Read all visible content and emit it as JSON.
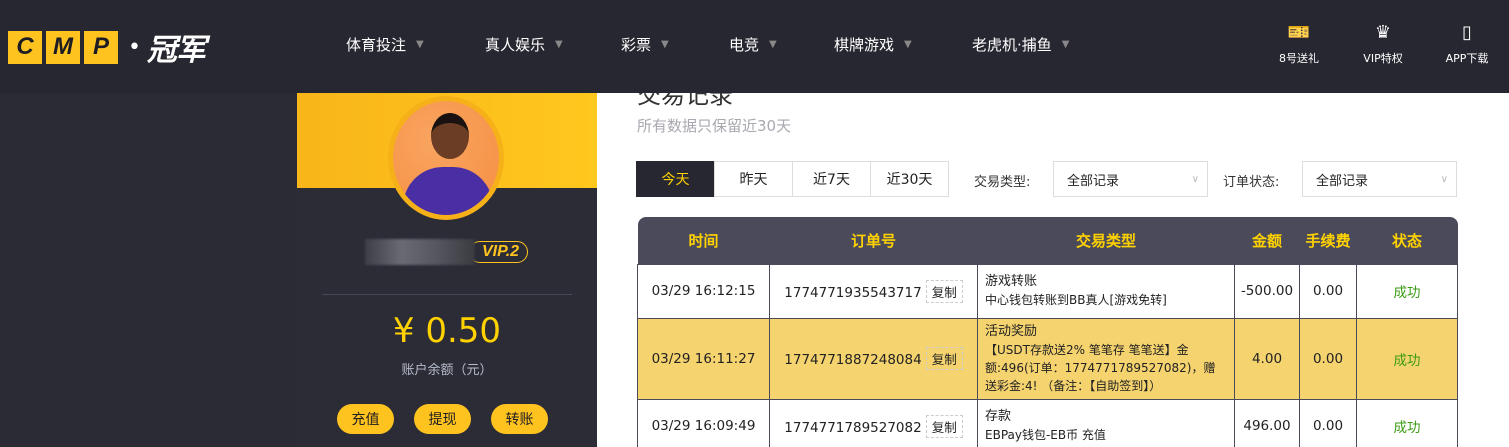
{
  "header": {
    "logo_letters": [
      "C",
      "M",
      "P"
    ],
    "logo_text": "冠军",
    "menu": [
      {
        "label": "体育投注"
      },
      {
        "label": "真人娱乐"
      },
      {
        "label": "彩票"
      },
      {
        "label": "电竞"
      },
      {
        "label": "棋牌游戏"
      },
      {
        "label": "老虎机·捕鱼"
      }
    ],
    "right_icons": [
      {
        "label": "8号送礼",
        "icon": "ticket-yen-icon"
      },
      {
        "label": "VIP特权",
        "icon": "crown-icon"
      },
      {
        "label": "APP下载",
        "icon": "phone-icon"
      }
    ]
  },
  "sidebar": {
    "vip": "VIP.2",
    "balance": "¥ 0.50",
    "balance_label": "账户余额（元）",
    "buttons": [
      "充值",
      "提现",
      "转账"
    ]
  },
  "main": {
    "title": "交易记录",
    "subtitle": "所有数据只保留近30天",
    "date_tabs": [
      "今天",
      "昨天",
      "近7天",
      "近30天"
    ],
    "active_tab": 0,
    "type_label": "交易类型:",
    "type_value": "全部记录",
    "status_label": "订单状态:",
    "status_value": "全部记录",
    "table": {
      "headers": [
        "时间",
        "订单号",
        "交易类型",
        "金额",
        "手续费",
        "状态"
      ],
      "copy_label": "复制",
      "rows": [
        {
          "time": "03/29 16:12:15",
          "order": "1774771935543717",
          "type": "游戏转账",
          "detail": "中心钱包转账到BB真人[游戏免转]",
          "amount": "-500.00",
          "fee": "0.00",
          "status": "成功"
        },
        {
          "time": "03/29 16:11:27",
          "order": "1774771887248084",
          "type": "活动奖励",
          "detail": "【USDT存款送2% 笔笔存 笔笔送】金额:496(订单：1774771789527082)，赠送彩金:4! （备注：【自助签到】）",
          "amount": "4.00",
          "fee": "0.00",
          "status": "成功"
        },
        {
          "time": "03/29 16:09:49",
          "order": "1774771789527082",
          "type": "存款",
          "detail": "EBPay钱包-EB币 充值",
          "amount": "496.00",
          "fee": "0.00",
          "status": "成功"
        }
      ]
    }
  },
  "colors": {
    "accent": "#ffc31f",
    "nav_bg": "#272731",
    "header_bg": "#4a4a5a",
    "highlight_row": "#f5d36f",
    "success": "#3a9b13"
  }
}
